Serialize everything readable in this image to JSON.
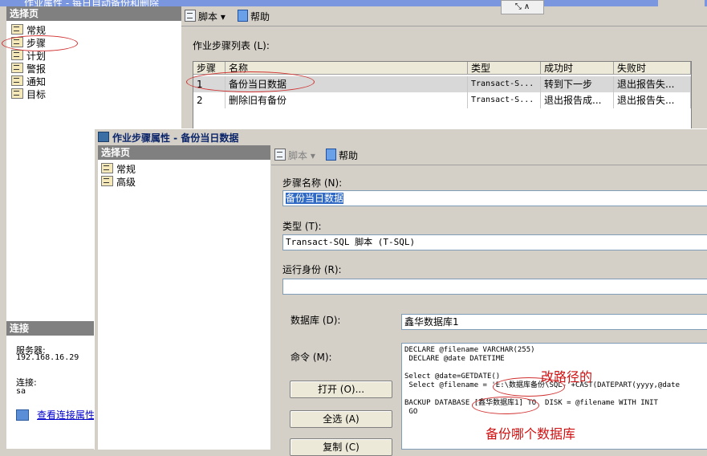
{
  "back_window": {
    "title": "作业属性 - 每日自动备份和删除",
    "select_page_header": "选择页",
    "nav_items": [
      {
        "label": "常规"
      },
      {
        "label": "步骤"
      },
      {
        "label": "计划"
      },
      {
        "label": "警报"
      },
      {
        "label": "通知"
      },
      {
        "label": "目标"
      }
    ],
    "toolbar": {
      "script_label": "脚本",
      "help_label": "帮助"
    },
    "steps_list_label": "作业步骤列表 (L):",
    "steps_table": {
      "columns": [
        "步骤",
        "名称",
        "类型",
        "成功时",
        "失败时"
      ],
      "rows": [
        [
          "1",
          "备份当日数据",
          "Transact-S...",
          "转到下一步",
          "退出报告失..."
        ],
        [
          "2",
          "删除旧有备份",
          "Transact-S...",
          "退出报告成...",
          "退出报告失..."
        ]
      ]
    },
    "connection": {
      "header": "连接",
      "server_label": "服务器:",
      "server_value": "192.168.16.29",
      "connection_label": "连接:",
      "connection_value": "sa",
      "view_properties_link": "查看连接属性"
    }
  },
  "front_dialog": {
    "title": "作业步骤属性 - 备份当日数据",
    "select_page_header": "选择页",
    "nav_items": [
      {
        "label": "常规"
      },
      {
        "label": "高级"
      }
    ],
    "toolbar": {
      "script_label": "脚本",
      "help_label": "帮助"
    },
    "step_name_label": "步骤名称 (N):",
    "step_name_value": "备份当日数据",
    "type_label": "类型 (T):",
    "type_value": "Transact-SQL 脚本 (T-SQL)",
    "run_as_label": "运行身份 (R):",
    "run_as_value": "",
    "database_label": "数据库 (D):",
    "database_value": "鑫华数据库1",
    "command_label": "命令 (M):",
    "command_lines": [
      "DECLARE @filename VARCHAR(255)",
      " DECLARE @date DATETIME",
      "",
      "Select @date=GETDATE()",
      " Select @filename = 'E:\\数据库备份\\SQL-'+CAST(DATEPART(yyyy,@date",
      "",
      "BACKUP DATABASE [鑫华数据库1] TO  DISK = @filename WITH INIT",
      " GO"
    ],
    "buttons": {
      "open": "打开 (O)...",
      "select_all": "全选 (A)",
      "copy": "复制 (C)"
    }
  },
  "annotations": {
    "path_note": "改路径的",
    "db_note": "备份哪个数据库"
  },
  "colors": {
    "title_blue": "#0a246a",
    "annotation_red": "#d01010",
    "pane_header_gray": "#808080"
  }
}
